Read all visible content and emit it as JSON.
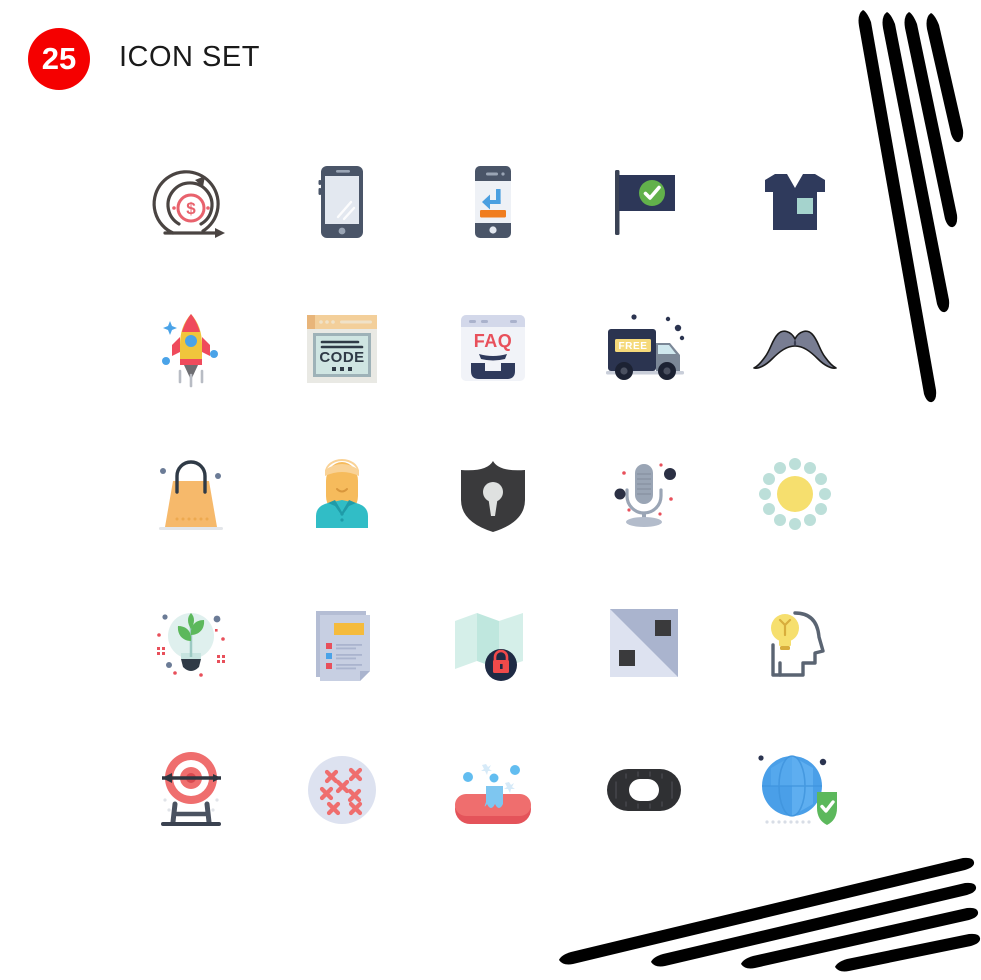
{
  "header": {
    "count": "25",
    "title": "ICON SET",
    "badge_color": "#f50000",
    "title_color": "#1a1a1a"
  },
  "decoration": {
    "stroke_color": "#000000",
    "top_right_strokes": 4,
    "bottom_right_strokes": 4
  },
  "grid": {
    "columns": 5,
    "rows": 5,
    "total": 25
  },
  "icons": [
    {
      "index": 1,
      "name": "agile-money-cycle-icon",
      "label": "Agile Money Cycle",
      "row": 1,
      "col": 1,
      "colors": [
        "#4a4442",
        "#e8626d"
      ]
    },
    {
      "index": 2,
      "name": "smartphone-icon",
      "label": "Smartphone",
      "row": 1,
      "col": 2,
      "colors": [
        "#4a5568",
        "#dfe3ec"
      ]
    },
    {
      "index": 3,
      "name": "mobile-download-icon",
      "label": "Mobile Download",
      "row": 1,
      "col": 3,
      "colors": [
        "#4a5568",
        "#4a9fe0",
        "#f07d1f"
      ]
    },
    {
      "index": 4,
      "name": "flag-check-icon",
      "label": "Flag Approved",
      "row": 1,
      "col": 4,
      "colors": [
        "#2d3758",
        "#62b14b"
      ]
    },
    {
      "index": 5,
      "name": "scrubs-uniform-icon",
      "label": "Scrubs Uniform",
      "row": 1,
      "col": 5,
      "colors": [
        "#2f3a5c",
        "#a5d3cd"
      ]
    },
    {
      "index": 6,
      "name": "rocket-launch-icon",
      "label": "Rocket Launch",
      "row": 2,
      "col": 1,
      "colors": [
        "#f0c53c",
        "#ef4b5c",
        "#4aa3e8"
      ]
    },
    {
      "index": 7,
      "name": "code-window-icon",
      "label": "Code Window",
      "row": 2,
      "col": 2,
      "colors": [
        "#f3cf9a",
        "#cfe5e2",
        "#2f3a46"
      ]
    },
    {
      "index": 8,
      "name": "faq-window-icon",
      "label": "FAQ Support",
      "row": 2,
      "col": 3,
      "colors": [
        "#eceef5",
        "#e8505b",
        "#2f3a5c"
      ]
    },
    {
      "index": 9,
      "name": "free-delivery-truck-icon",
      "label": "Free Delivery Truck",
      "row": 2,
      "col": 4,
      "colors": [
        "#2b3450",
        "#f5d97a",
        "#cfe7ee"
      ]
    },
    {
      "index": 10,
      "name": "mustache-icon",
      "label": "Mustache",
      "row": 2,
      "col": 5,
      "colors": [
        "#787d92",
        "#1a1a1a"
      ]
    },
    {
      "index": 11,
      "name": "shopping-bag-icon",
      "label": "Shopping Bag",
      "row": 3,
      "col": 1,
      "colors": [
        "#f6b96b",
        "#2f3a46"
      ]
    },
    {
      "index": 12,
      "name": "person-avatar-icon",
      "label": "Person Avatar",
      "row": 3,
      "col": 2,
      "colors": [
        "#f6bb5c",
        "#31bdc6"
      ]
    },
    {
      "index": 13,
      "name": "security-shield-icon",
      "label": "Security Shield",
      "row": 3,
      "col": 3,
      "colors": [
        "#3a3a3c",
        "#dfe1e0"
      ]
    },
    {
      "index": 14,
      "name": "microphone-icon",
      "label": "Microphone",
      "row": 3,
      "col": 4,
      "colors": [
        "#9aa5b5",
        "#2b3044",
        "#e8505b"
      ]
    },
    {
      "index": 15,
      "name": "sun-dots-icon",
      "label": "Sun",
      "row": 3,
      "col": 5,
      "colors": [
        "#f6df6e",
        "#bcdfd9"
      ]
    },
    {
      "index": 16,
      "name": "eco-lightbulb-icon",
      "label": "Eco Idea Bulb",
      "row": 4,
      "col": 1,
      "colors": [
        "#5cb85c",
        "#dff0ee",
        "#2f3a46",
        "#e8505b"
      ]
    },
    {
      "index": 17,
      "name": "document-checklist-icon",
      "label": "Document Checklist",
      "row": 4,
      "col": 2,
      "colors": [
        "#b4bdd4",
        "#f5bb3c",
        "#e8505b",
        "#4aa3e8"
      ]
    },
    {
      "index": 18,
      "name": "map-lock-icon",
      "label": "Map Locked",
      "row": 4,
      "col": 3,
      "colors": [
        "#cdeae4",
        "#1e2a44",
        "#f04a4a"
      ]
    },
    {
      "index": 19,
      "name": "diagonal-split-square-icon",
      "label": "Diagonal Split Square",
      "row": 4,
      "col": 4,
      "colors": [
        "#dde2f0",
        "#aab4ce",
        "#3a3a3c"
      ]
    },
    {
      "index": 20,
      "name": "head-idea-icon",
      "label": "Creative Mind",
      "row": 4,
      "col": 5,
      "colors": [
        "#5a6472",
        "#f6df6e"
      ]
    },
    {
      "index": 21,
      "name": "target-arrow-icon",
      "label": "Target Arrow",
      "row": 5,
      "col": 1,
      "colors": [
        "#ef6e6e",
        "#4a5260"
      ]
    },
    {
      "index": 22,
      "name": "germs-circle-icon",
      "label": "Germs",
      "row": 5,
      "col": 2,
      "colors": [
        "#dde2f0",
        "#ef6e6e"
      ]
    },
    {
      "index": 23,
      "name": "soap-bubbles-icon",
      "label": "Soap Bubbles",
      "row": 5,
      "col": 3,
      "colors": [
        "#e4535a",
        "#7ec6f0"
      ]
    },
    {
      "index": 24,
      "name": "tire-oval-icon",
      "label": "Tire",
      "row": 5,
      "col": 4,
      "colors": [
        "#2f3033"
      ]
    },
    {
      "index": 25,
      "name": "globe-secure-icon",
      "label": "Secure Globe",
      "row": 5,
      "col": 5,
      "colors": [
        "#4a9fe8",
        "#5cb85c"
      ]
    }
  ]
}
